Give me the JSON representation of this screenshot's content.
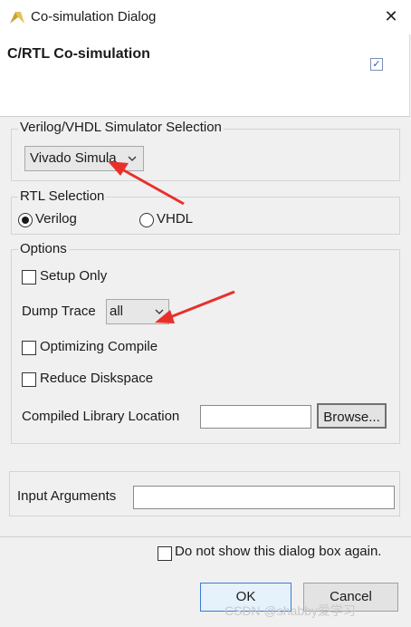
{
  "window": {
    "title": "Co-simulation Dialog",
    "close_glyph": "✕"
  },
  "header": {
    "title": "C/RTL Co-simulation",
    "checked": true,
    "check_glyph": "✓"
  },
  "simulator": {
    "legend": "Verilog/VHDL Simulator Selection",
    "selected": "Vivado Simula",
    "chevron": "⌵"
  },
  "rtl": {
    "legend": "RTL Selection",
    "options": [
      {
        "label": "Verilog",
        "selected": true
      },
      {
        "label": "VHDL",
        "selected": false
      }
    ]
  },
  "options": {
    "legend": "Options",
    "setup_only": "Setup Only",
    "dump_trace_label": "Dump Trace",
    "dump_trace_value": "all",
    "optimizing_compile": "Optimizing Compile",
    "reduce_diskspace": "Reduce Diskspace",
    "compiled_library_label": "Compiled Library Location",
    "compiled_library_value": "",
    "browse": "Browse..."
  },
  "input_arguments": {
    "label": "Input Arguments",
    "value": ""
  },
  "footer": {
    "dont_show": "Do not show this dialog box again.",
    "ok": "OK",
    "cancel": "Cancel"
  },
  "watermark": "CSDN @shabby爱学习",
  "colors": {
    "arrow": "#e8302a",
    "accent": "#3a7bd5"
  }
}
